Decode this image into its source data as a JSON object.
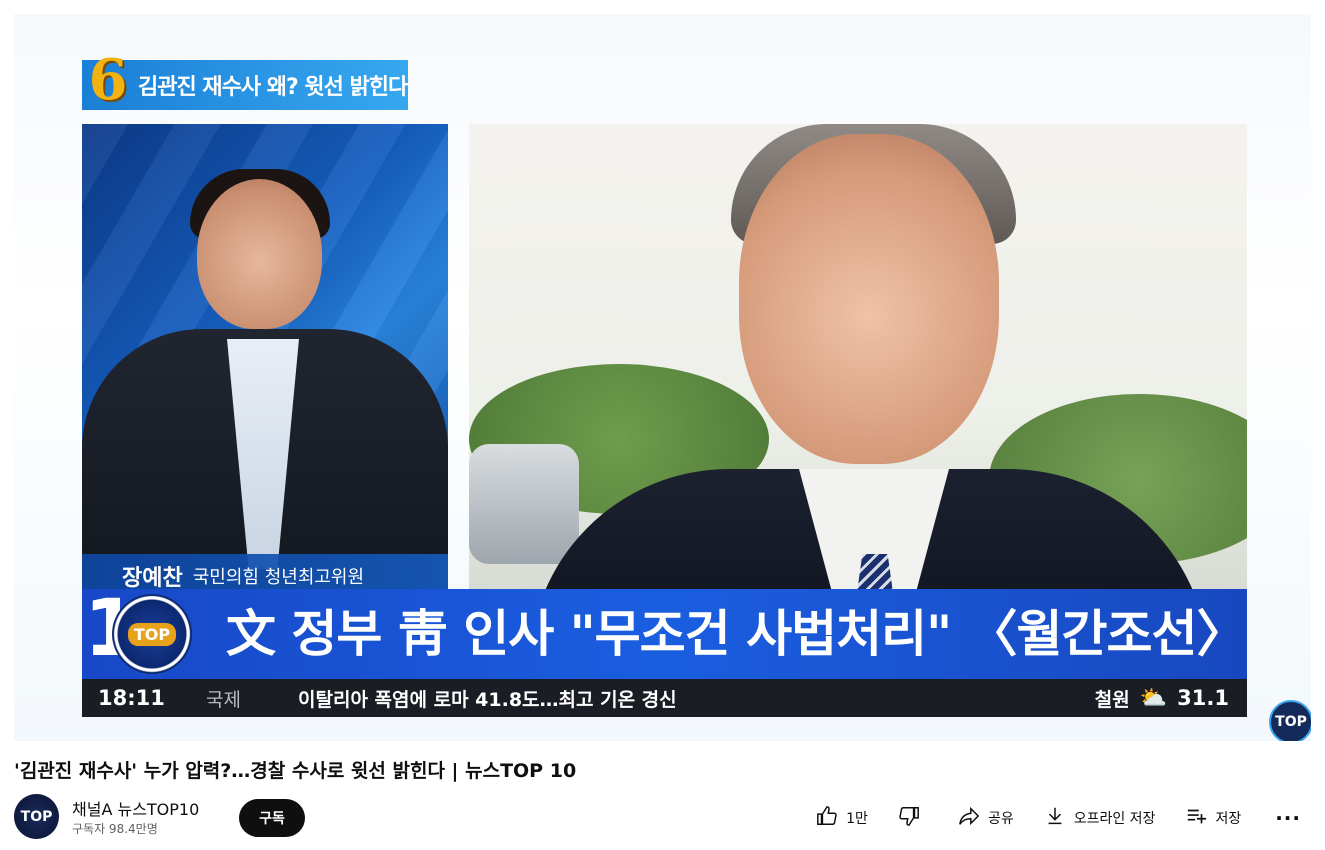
{
  "video": {
    "segment_number": "6",
    "segment_title": "김관진 재수사 왜? 윗선 밝힌다",
    "guest_name": "장예찬",
    "guest_role": "국민의힘 청년최고위원",
    "logo_number": "10",
    "logo_text": "TOP",
    "headline": "文 정부 靑 인사 \"무조건 사법처리\" 〈월간조선〉",
    "ticker": {
      "time": "18:11",
      "category": "국제",
      "news": "이탈리아 폭염에 로마 41.8도…최고 기온 경신",
      "city": "철원",
      "weather_icon": "partly-sunny-icon",
      "temperature": "31.1"
    },
    "watermark": "TOP"
  },
  "title": "'김관진 재수사' 누가 압력?…경찰 수사로 윗선 밝힌다 | 뉴스TOP 10",
  "channel": {
    "name": "채널A 뉴스TOP10",
    "subscribers": "구독자 98.4만명",
    "avatar_text": "TOP",
    "subscribe_label": "구독"
  },
  "actions": {
    "like_count": "1만",
    "share_label": "공유",
    "download_label": "오프라인 저장",
    "save_label": "저장",
    "more_label": "···"
  }
}
